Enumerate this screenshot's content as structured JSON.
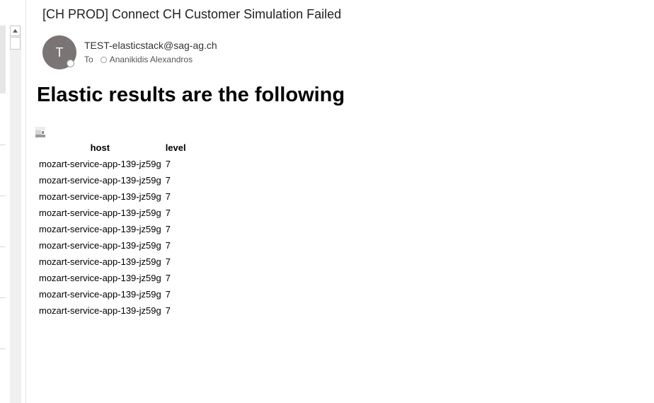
{
  "email": {
    "subject": "[CH PROD] Connect CH Customer Simulation Failed",
    "avatar_initial": "T",
    "sender": "TEST-elasticstack@sag-ag.ch",
    "to_label": "To",
    "recipient": "Ananikidis Alexandros"
  },
  "body": {
    "heading": "Elastic results are the following",
    "table": {
      "columns": [
        "host",
        "level"
      ],
      "rows": [
        [
          "mozart-service-app-139-jz59g",
          "7"
        ],
        [
          "mozart-service-app-139-jz59g",
          "7"
        ],
        [
          "mozart-service-app-139-jz59g",
          "7"
        ],
        [
          "mozart-service-app-139-jz59g",
          "7"
        ],
        [
          "mozart-service-app-139-jz59g",
          "7"
        ],
        [
          "mozart-service-app-139-jz59g",
          "7"
        ],
        [
          "mozart-service-app-139-jz59g",
          "7"
        ],
        [
          "mozart-service-app-139-jz59g",
          "7"
        ],
        [
          "mozart-service-app-139-jz59g",
          "7"
        ],
        [
          "mozart-service-app-139-jz59g",
          "7"
        ]
      ]
    }
  },
  "icons": {
    "scroll_up": "chevron-up-icon",
    "broken_image": "broken-image-icon",
    "presence": "presence-status-icon"
  },
  "colors": {
    "avatar": "#7a7574",
    "pane_border": "#e1e1e1"
  }
}
